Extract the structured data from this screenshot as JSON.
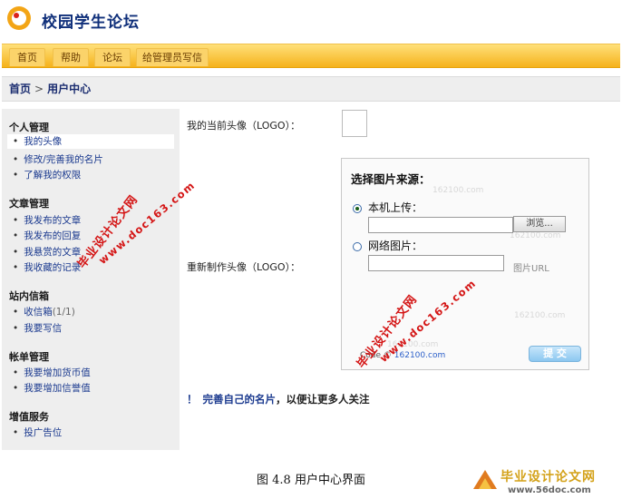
{
  "header": {
    "site_title": "校园学生论坛"
  },
  "nav": {
    "items": [
      "首页",
      "帮助",
      "论坛",
      "给管理员写信"
    ]
  },
  "breadcrumb": {
    "home": "首页",
    "sep": ">",
    "current": "用户中心"
  },
  "sidebar": {
    "sections": [
      {
        "title": "个人管理",
        "items": [
          "我的头像",
          "修改/完善我的名片",
          "了解我的权限"
        ]
      },
      {
        "title": "文章管理",
        "items": [
          "我发布的文章",
          "我发布的回复",
          "我悬赏的文章",
          "我收藏的记录"
        ]
      },
      {
        "title": "站内信箱",
        "items": [
          "收信箱",
          "我要写信"
        ],
        "inbox_count": "(1/1)"
      },
      {
        "title": "帐单管理",
        "items": [
          "我要增加货币值",
          "我要增加信誉值"
        ]
      },
      {
        "title": "增值服务",
        "items": [
          "投广告位"
        ]
      }
    ]
  },
  "main": {
    "current_avatar_label": "我的当前头像（LOGO）：",
    "remake_avatar_label": "重新制作头像（LOGO）：",
    "panel": {
      "title": "选择图片来源：",
      "local_upload": "本机上传：",
      "browse_button": "浏览...",
      "network_image": "网络图片：",
      "url_hint": "图片URL",
      "code_by": "Code ©",
      "code_link": "162100.com",
      "submit": "提 交",
      "bg_watermark": "162100.com",
      "local_selected": true
    },
    "tip": {
      "mark": "！",
      "link": "完善自己的名片",
      "rest": "，以便让更多人关注"
    }
  },
  "caption": "图 4.8 用户中心界面",
  "watermarks": {
    "stamp_text": "毕业设计论文网",
    "stamp_url": "www.doc163.com",
    "corner_title": "毕业设计论文网",
    "corner_url": "www.56doc.com"
  },
  "colors": {
    "nav_gradient_top": "#ffe07a",
    "nav_gradient_bottom": "#f5b21b",
    "link_blue": "#1b3a8f",
    "stamp_red": "#d41515"
  }
}
